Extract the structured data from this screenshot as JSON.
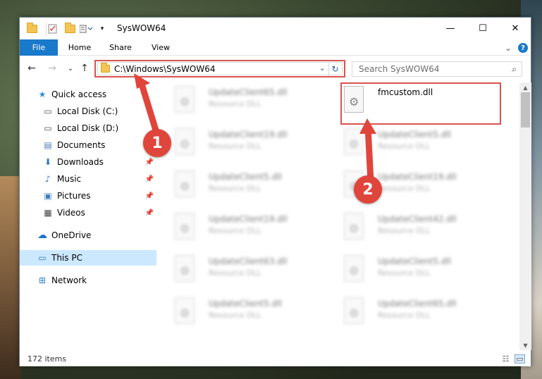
{
  "window": {
    "title": "SysWOW64",
    "minimize": "—",
    "maximize": "☐",
    "close": "✕"
  },
  "ribbon": {
    "tabs": [
      "File",
      "Home",
      "Share",
      "View"
    ],
    "expand": "⌄",
    "help": "?"
  },
  "nav": {
    "back": "←",
    "forward": "→",
    "recent": "⌄",
    "up": "↑"
  },
  "address": {
    "path": "C:\\Windows\\SysWOW64",
    "dropdown": "⌄",
    "refresh": "↻"
  },
  "search": {
    "placeholder": "Search SysWOW64",
    "icon": "⌕"
  },
  "sidebar": {
    "items": [
      {
        "label": "Quick access",
        "icon": "star-icon",
        "glyph": "★",
        "pinned": false
      },
      {
        "label": "Local Disk (C:)",
        "icon": "drive-icon",
        "glyph": "▭",
        "pinned": false
      },
      {
        "label": "Local Disk (D:)",
        "icon": "drive-icon",
        "glyph": "▭",
        "pinned": false
      },
      {
        "label": "Documents",
        "icon": "documents-icon",
        "glyph": "▤",
        "pinned": true
      },
      {
        "label": "Downloads",
        "icon": "download-icon",
        "glyph": "⬇",
        "pinned": true
      },
      {
        "label": "Music",
        "icon": "music-icon",
        "glyph": "♪",
        "pinned": true
      },
      {
        "label": "Pictures",
        "icon": "pictures-icon",
        "glyph": "▣",
        "pinned": true
      },
      {
        "label": "Videos",
        "icon": "videos-icon",
        "glyph": "▦",
        "pinned": true
      },
      {
        "label": "OneDrive",
        "icon": "cloud-icon",
        "glyph": "☁",
        "pinned": false
      },
      {
        "label": "This PC",
        "icon": "computer-icon",
        "glyph": "▭",
        "pinned": false
      },
      {
        "label": "Network",
        "icon": "network-icon",
        "glyph": "⊞",
        "pinned": false
      }
    ],
    "pin_glyph": "📌"
  },
  "files": {
    "left": [
      {
        "name": "UpdateClient65.dll",
        "type": "Resource DLL"
      },
      {
        "name": "UpdateClient19.dll",
        "type": "Resource DLL"
      },
      {
        "name": "UpdateClient5.dll",
        "type": "Resource DLL"
      },
      {
        "name": "UpdateClient19.dll",
        "type": "Resource DLL"
      },
      {
        "name": "UpdateClient63.dll",
        "type": "Resource DLL"
      },
      {
        "name": "UpdateClient5.dll",
        "type": "Resource DLL"
      }
    ],
    "right": [
      {
        "name": "fmcustom.dll",
        "type": ""
      },
      {
        "name": "UpdateClient5.dll",
        "type": "Resource DLL"
      },
      {
        "name": "UpdateClient19.dll",
        "type": "Resource DLL"
      },
      {
        "name": "UpdateClient42.dll",
        "type": "Resource DLL"
      },
      {
        "name": "UpdateClient5.dll",
        "type": "Resource DLL"
      },
      {
        "name": "UpdateClient65.dll",
        "type": "Resource DLL"
      }
    ]
  },
  "status": {
    "count": "172 items"
  },
  "callouts": [
    "1",
    "2"
  ],
  "colors": {
    "accent": "#1979ca",
    "annotation": "#e0453c",
    "selection": "#cce8ff"
  }
}
